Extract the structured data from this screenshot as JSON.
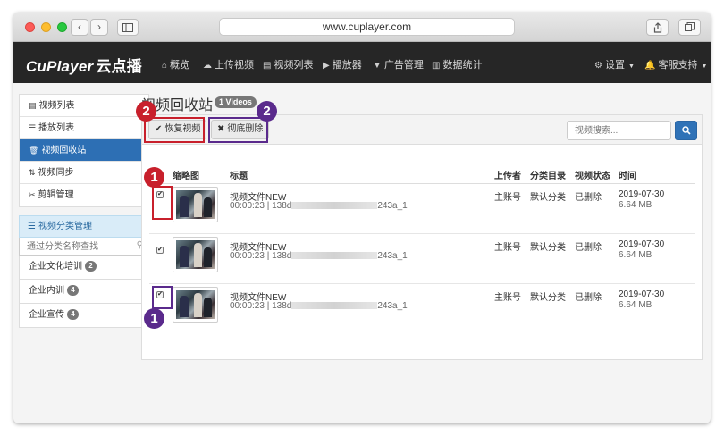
{
  "browser": {
    "url": "www.cuplayer.com",
    "back_glyph": "‹",
    "forward_glyph": "›"
  },
  "app": {
    "brand_latin": "CuPlayer",
    "brand_cn": "云点播",
    "nav": [
      {
        "label": "概览",
        "icon": "home-icon",
        "glyph": "⌂"
      },
      {
        "label": "上传视频",
        "icon": "cloud-upload-icon",
        "glyph": "☁"
      },
      {
        "label": "视频列表",
        "icon": "film-icon",
        "glyph": "▤"
      },
      {
        "label": "播放器",
        "icon": "play-circle-icon",
        "glyph": "▶"
      },
      {
        "label": "广告管理",
        "icon": "filter-icon",
        "glyph": "▼"
      },
      {
        "label": "数据统计",
        "icon": "bar-chart-icon",
        "glyph": "▥"
      }
    ],
    "settings_label": "设置",
    "support_label": "客服支持"
  },
  "sidebar": {
    "items": [
      {
        "label": "视频列表",
        "glyph": "▤",
        "active": false
      },
      {
        "label": "播放列表",
        "glyph": "☰",
        "active": false
      },
      {
        "label": "视频回收站",
        "glyph": "🗑",
        "active": true
      },
      {
        "label": "视频同步",
        "glyph": "⇅",
        "active": false
      },
      {
        "label": "剪辑管理",
        "glyph": "✂",
        "active": false
      }
    ],
    "category_title": "视频分类管理",
    "category_search_placeholder": "通过分类名称查找",
    "categories": [
      {
        "label": "企业文化培训",
        "count": "2"
      },
      {
        "label": "企业内训",
        "count": "4"
      },
      {
        "label": "企业宣传",
        "count": "4"
      }
    ]
  },
  "main": {
    "title": "视频回收站",
    "count_badge": "1 Videos",
    "restore_label": "恢复视频",
    "delete_label": "彻底删除",
    "search_placeholder": "视频搜索..."
  },
  "table": {
    "headers": [
      "缩略图",
      "标题",
      "上传者",
      "分类目录",
      "视频状态",
      "时间"
    ],
    "rows": [
      {
        "checked": true,
        "title": "视频文件NEW",
        "duration": "00:00:23",
        "id_start": "138d",
        "id_end": "243a_1",
        "uploader": "主账号",
        "category": "默认分类",
        "status": "已删除",
        "date": "2019-07-30",
        "size": "6.64 MB"
      },
      {
        "checked": true,
        "title": "视频文件NEW",
        "duration": "00:00:23",
        "id_start": "138d",
        "id_end": "243a_1",
        "uploader": "主账号",
        "category": "默认分类",
        "status": "已删除",
        "date": "2019-07-30",
        "size": "6.64 MB"
      },
      {
        "checked": true,
        "title": "视频文件NEW",
        "duration": "00:00:23",
        "id_start": "138d",
        "id_end": "243a_1",
        "uploader": "主账号",
        "category": "默认分类",
        "status": "已删除",
        "date": "2019-07-30",
        "size": "6.64 MB"
      }
    ]
  },
  "annotations": {
    "restore_marker": "2",
    "delete_marker": "2",
    "row_marker_red": "1",
    "row_marker_purple": "1",
    "red": "#c8202c",
    "purple": "#5a2a8c"
  }
}
